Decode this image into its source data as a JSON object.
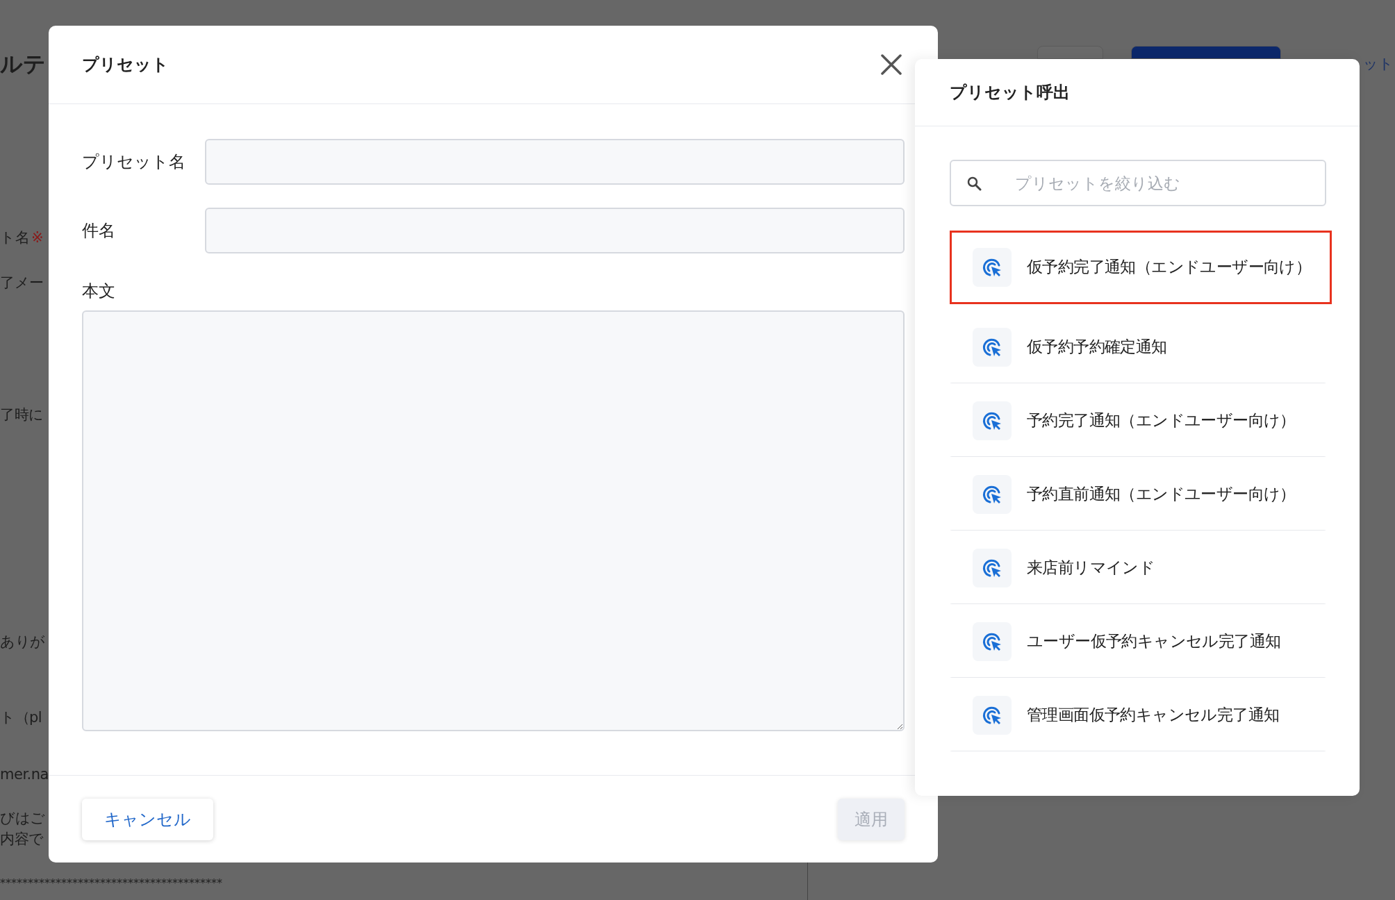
{
  "background": {
    "heading": "ルテ",
    "top_right_text": "ット",
    "lines": [
      {
        "text": "ト名",
        "note": "※"
      },
      {
        "text": "了メー"
      },
      {
        "text": "了時に"
      },
      {
        "text": "ありが"
      },
      {
        "text": "ト（pl"
      },
      {
        "text": "mer.na"
      },
      {
        "text": "びはご"
      },
      {
        "text": "内容で"
      },
      {
        "text": "****************************************"
      }
    ]
  },
  "dialog": {
    "title": "プリセット",
    "fields": [
      {
        "label": "プリセット名",
        "kind": "line"
      },
      {
        "label": "件名",
        "kind": "line"
      },
      {
        "label": "本文",
        "kind": "area"
      }
    ],
    "cancel": {
      "label": "キャンセル"
    },
    "apply": {
      "label": "適用",
      "disabled": true
    }
  },
  "preset_panel": {
    "title": "プリセット呼出",
    "search": {
      "placeholder": "プリセットを絞り込む"
    },
    "items": [
      {
        "label": "仮予約完了通知（エンドユーザー向け）",
        "selected": true
      },
      {
        "label": "仮予約予約確定通知",
        "selected": false
      },
      {
        "label": "予約完了通知（エンドユーザー向け）",
        "selected": false
      },
      {
        "label": "予約直前通知（エンドユーザー向け）",
        "selected": false
      },
      {
        "label": "来店前リマインド",
        "selected": false
      },
      {
        "label": "ユーザー仮予約キャンセル完了通知",
        "selected": false
      },
      {
        "label": "管理画面仮予約キャンセル完了通知",
        "selected": false
      }
    ]
  }
}
